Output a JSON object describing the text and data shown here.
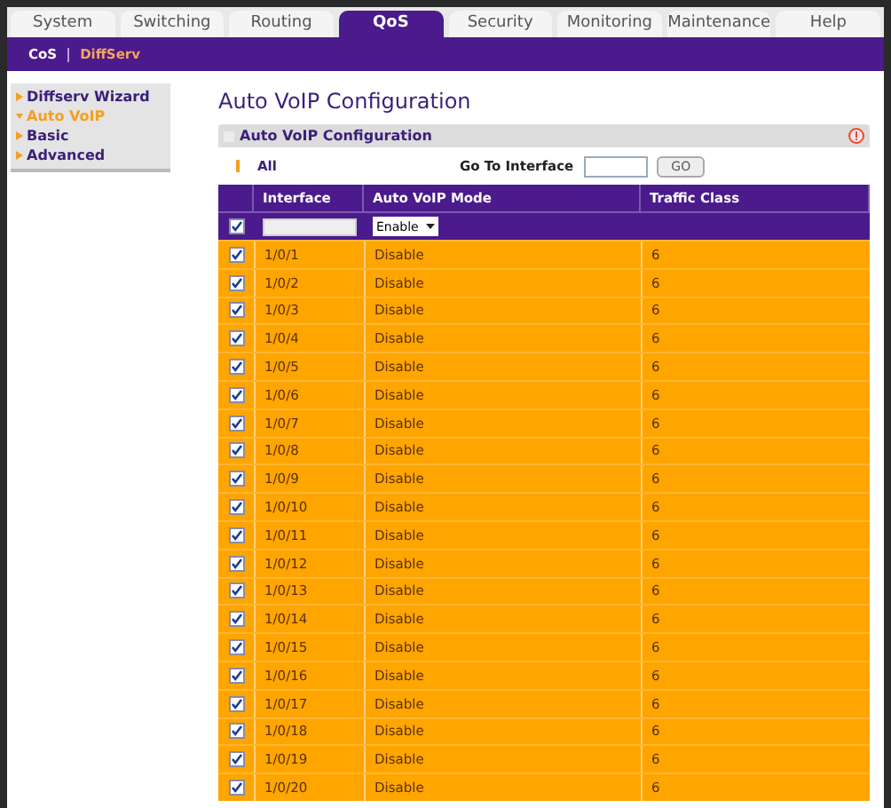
{
  "tabs": [
    {
      "label": "System",
      "selected": false
    },
    {
      "label": "Switching",
      "selected": false
    },
    {
      "label": "Routing",
      "selected": false
    },
    {
      "label": "QoS",
      "selected": true
    },
    {
      "label": "Security",
      "selected": false
    },
    {
      "label": "Monitoring",
      "selected": false
    },
    {
      "label": "Maintenance",
      "selected": false
    },
    {
      "label": "Help",
      "selected": false
    }
  ],
  "subnav": [
    {
      "label": "CoS",
      "selected": false
    },
    {
      "label": "DiffServ",
      "selected": true
    }
  ],
  "sidebar": [
    {
      "label": "Diffserv Wizard",
      "selected": false
    },
    {
      "label": "Auto VoIP",
      "selected": true
    },
    {
      "label": "Basic",
      "selected": false
    },
    {
      "label": "Advanced",
      "selected": false
    }
  ],
  "page_title": "Auto VoIP Configuration",
  "panel": {
    "title": "Auto VoIP Configuration",
    "all_label": "All",
    "goto_label": "Go To Interface",
    "go_button": "GO",
    "columns": [
      "Interface",
      "Auto VoIP Mode",
      "Traffic Class"
    ],
    "filter": {
      "checked": true,
      "mode": "Enable"
    },
    "rows": [
      {
        "interface": "1/0/1",
        "mode": "Disable",
        "traffic_class": "6",
        "checked": true
      },
      {
        "interface": "1/0/2",
        "mode": "Disable",
        "traffic_class": "6",
        "checked": true
      },
      {
        "interface": "1/0/3",
        "mode": "Disable",
        "traffic_class": "6",
        "checked": true
      },
      {
        "interface": "1/0/4",
        "mode": "Disable",
        "traffic_class": "6",
        "checked": true
      },
      {
        "interface": "1/0/5",
        "mode": "Disable",
        "traffic_class": "6",
        "checked": true
      },
      {
        "interface": "1/0/6",
        "mode": "Disable",
        "traffic_class": "6",
        "checked": true
      },
      {
        "interface": "1/0/7",
        "mode": "Disable",
        "traffic_class": "6",
        "checked": true
      },
      {
        "interface": "1/0/8",
        "mode": "Disable",
        "traffic_class": "6",
        "checked": true
      },
      {
        "interface": "1/0/9",
        "mode": "Disable",
        "traffic_class": "6",
        "checked": true
      },
      {
        "interface": "1/0/10",
        "mode": "Disable",
        "traffic_class": "6",
        "checked": true
      },
      {
        "interface": "1/0/11",
        "mode": "Disable",
        "traffic_class": "6",
        "checked": true
      },
      {
        "interface": "1/0/12",
        "mode": "Disable",
        "traffic_class": "6",
        "checked": true
      },
      {
        "interface": "1/0/13",
        "mode": "Disable",
        "traffic_class": "6",
        "checked": true
      },
      {
        "interface": "1/0/14",
        "mode": "Disable",
        "traffic_class": "6",
        "checked": true
      },
      {
        "interface": "1/0/15",
        "mode": "Disable",
        "traffic_class": "6",
        "checked": true
      },
      {
        "interface": "1/0/16",
        "mode": "Disable",
        "traffic_class": "6",
        "checked": true
      },
      {
        "interface": "1/0/17",
        "mode": "Disable",
        "traffic_class": "6",
        "checked": true
      },
      {
        "interface": "1/0/18",
        "mode": "Disable",
        "traffic_class": "6",
        "checked": true
      },
      {
        "interface": "1/0/19",
        "mode": "Disable",
        "traffic_class": "6",
        "checked": true
      },
      {
        "interface": "1/0/20",
        "mode": "Disable",
        "traffic_class": "6",
        "checked": true
      }
    ]
  }
}
